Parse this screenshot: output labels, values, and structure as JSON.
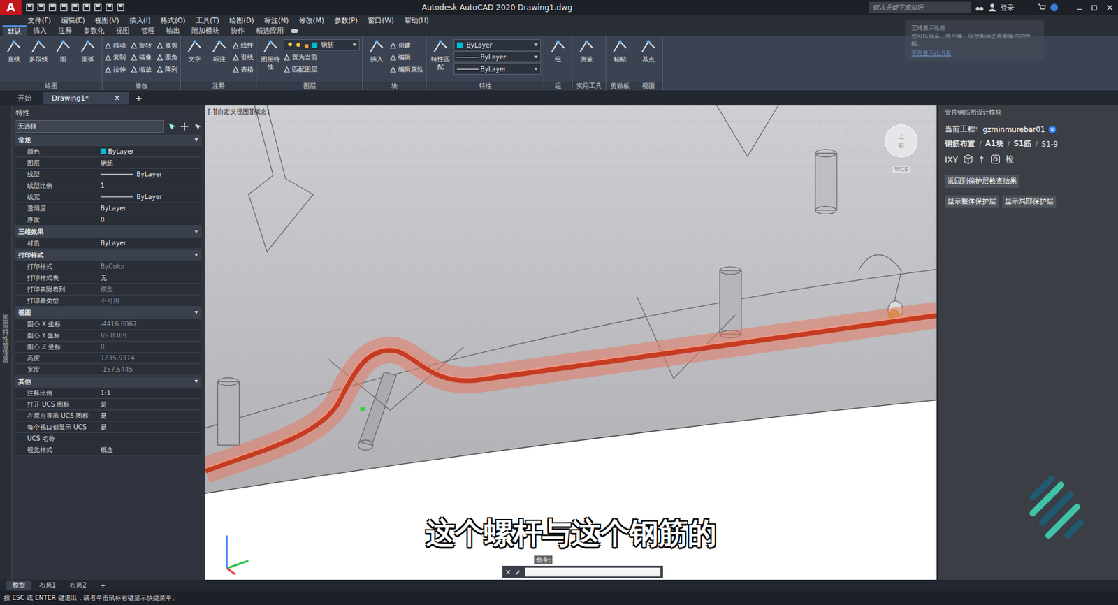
{
  "window": {
    "app_icon": "A",
    "title": "Autodesk AutoCAD 2020    Drawing1.dwg",
    "search_placeholder": "键入关键字或短语",
    "login": "登录"
  },
  "menu": [
    "文件(F)",
    "编辑(E)",
    "视图(V)",
    "插入(I)",
    "格式(O)",
    "工具(T)",
    "绘图(D)",
    "标注(N)",
    "修改(M)",
    "参数(P)",
    "窗口(W)",
    "帮助(H)"
  ],
  "ribbon_tabs": [
    {
      "label": "默认",
      "selected": true
    },
    {
      "label": "插入",
      "selected": false
    },
    {
      "label": "注释",
      "selected": false
    },
    {
      "label": "参数化",
      "selected": false
    },
    {
      "label": "视图",
      "selected": false
    },
    {
      "label": "管理",
      "selected": false
    },
    {
      "label": "输出",
      "selected": false
    },
    {
      "label": "附加模块",
      "selected": false
    },
    {
      "label": "协作",
      "selected": false
    },
    {
      "label": "精选应用",
      "selected": false
    }
  ],
  "ribbon_groups": [
    {
      "title": "绘图",
      "large": [
        "直线",
        "多段线",
        "圆",
        "圆弧"
      ],
      "dropdowns": [],
      "small": []
    },
    {
      "title": "修改",
      "large": [],
      "dropdowns": [],
      "small": [
        "移动",
        "复制",
        "拉伸",
        "旋转",
        "镜像",
        "缩放",
        "修剪",
        "圆角",
        "阵列"
      ]
    },
    {
      "title": "注释",
      "large": [
        "文字",
        "标注"
      ],
      "dropdowns": [],
      "small": [
        "线性",
        "引线",
        "表格"
      ]
    },
    {
      "title": "图层",
      "large": [
        "图层特性"
      ],
      "dropdowns": [
        {
          "label": "钢筋",
          "kind": "layer",
          "color": "#00bcd4"
        }
      ],
      "small": [
        "置为当前",
        "匹配图层"
      ]
    },
    {
      "title": "块",
      "large": [
        "插入"
      ],
      "dropdowns": [],
      "small": [
        "创建",
        "编辑",
        "编辑属性"
      ]
    },
    {
      "title": "特性",
      "large": [
        "特性匹配"
      ],
      "dropdowns": [
        {
          "label": "ByLayer",
          "kind": "color",
          "color": "#00bcd4"
        },
        {
          "label": "ByLayer",
          "kind": "line",
          "color": "#dddddd"
        },
        {
          "label": "ByLayer",
          "kind": "line",
          "color": "#dddddd"
        }
      ],
      "small": []
    },
    {
      "title": "组",
      "large": [
        "组"
      ],
      "dropdowns": [],
      "small": []
    },
    {
      "title": "实用工具",
      "large": [
        "测量"
      ],
      "dropdowns": [],
      "small": []
    },
    {
      "title": "剪贴板",
      "large": [
        "粘贴"
      ],
      "dropdowns": [],
      "small": []
    },
    {
      "title": "视图",
      "large": [
        "基点"
      ],
      "dropdowns": [],
      "small": []
    }
  ],
  "notification": {
    "title": "三维显示性能",
    "body": "您可以提高三维平移、缩放和动态观察操作的性能。",
    "link": "不再显示此消息"
  },
  "doc_tabs": [
    {
      "label": "开始",
      "selected": false
    },
    {
      "label": "Drawing1*",
      "selected": true
    }
  ],
  "doc_tab_close": "×",
  "doc_tab_new": "+",
  "side_strip": "图层特性管理器",
  "properties": {
    "title": "特性",
    "selection": "无选择",
    "toggle": "▾",
    "sections": [
      {
        "title": "常规",
        "expanded": true,
        "rows": [
          {
            "label": "颜色",
            "value": "ByLayer",
            "kind": "swatch",
            "color": "#00bcd4",
            "disabled": false
          },
          {
            "label": "图层",
            "value": "钢筋",
            "kind": "plain",
            "color": "",
            "disabled": false
          },
          {
            "label": "线型",
            "value": "ByLayer",
            "kind": "line",
            "color": "",
            "disabled": false
          },
          {
            "label": "线型比例",
            "value": "1",
            "kind": "plain",
            "color": "",
            "disabled": false
          },
          {
            "label": "线宽",
            "value": "ByLayer",
            "kind": "line",
            "color": "",
            "disabled": false
          },
          {
            "label": "透明度",
            "value": "ByLayer",
            "kind": "plain",
            "color": "",
            "disabled": false
          },
          {
            "label": "厚度",
            "value": "0",
            "kind": "plain",
            "color": "",
            "disabled": false
          }
        ]
      },
      {
        "title": "三维效果",
        "expanded": true,
        "rows": [
          {
            "label": "材质",
            "value": "ByLayer",
            "kind": "plain",
            "color": "",
            "disabled": false
          }
        ]
      },
      {
        "title": "打印样式",
        "expanded": true,
        "rows": [
          {
            "label": "打印样式",
            "value": "ByColor",
            "kind": "plain",
            "color": "",
            "disabled": true
          },
          {
            "label": "打印样式表",
            "value": "无",
            "kind": "plain",
            "color": "",
            "disabled": false
          },
          {
            "label": "打印表附着到",
            "value": "模型",
            "kind": "plain",
            "color": "",
            "disabled": true
          },
          {
            "label": "打印表类型",
            "value": "不可用",
            "kind": "plain",
            "color": "",
            "disabled": true
          }
        ]
      },
      {
        "title": "视图",
        "expanded": true,
        "rows": [
          {
            "label": "圆心 X 坐标",
            "value": "-4416.8067",
            "kind": "plain",
            "color": "",
            "disabled": true
          },
          {
            "label": "圆心 Y 坐标",
            "value": "65.8369",
            "kind": "plain",
            "color": "",
            "disabled": true
          },
          {
            "label": "圆心 Z 坐标",
            "value": "0",
            "kind": "plain",
            "color": "",
            "disabled": true
          },
          {
            "label": "高度",
            "value": "1235.9314",
            "kind": "plain",
            "color": "",
            "disabled": true
          },
          {
            "label": "宽度",
            "value": "-157.5445",
            "kind": "plain",
            "color": "",
            "disabled": true
          }
        ]
      },
      {
        "title": "其他",
        "expanded": true,
        "rows": [
          {
            "label": "注释比例",
            "value": "1:1",
            "kind": "plain",
            "color": "",
            "disabled": false
          },
          {
            "label": "打开 UCS 图标",
            "value": "是",
            "kind": "plain",
            "color": "",
            "disabled": false
          },
          {
            "label": "在原点显示 UCS 图标",
            "value": "是",
            "kind": "plain",
            "color": "",
            "disabled": false
          },
          {
            "label": "每个视口都显示 UCS",
            "value": "是",
            "kind": "plain",
            "color": "",
            "disabled": false
          },
          {
            "label": "UCS 名称",
            "value": "",
            "kind": "plain",
            "color": "",
            "disabled": false
          },
          {
            "label": "视觉样式",
            "value": "概念",
            "kind": "plain",
            "color": "",
            "disabled": false
          }
        ]
      }
    ]
  },
  "viewport": {
    "label": "[-][自定义视图][概念]",
    "cube_top": "上",
    "cube_right": "右",
    "wcs": "WCS",
    "subtitle": "这个螺杆与这个钢筋的",
    "command_label": "命令:",
    "command_close": "×"
  },
  "right_panel": {
    "title": "管片钢筋图设计模块",
    "project_label": "当前工程:",
    "project": "gzminmurebar01",
    "breadcrumb": [
      "钢筋布置",
      "A1块",
      "S1筋",
      "S1-9"
    ],
    "breadcrumb_sep": "/",
    "tools": [
      {
        "kind": "text",
        "label": "IXY"
      },
      {
        "kind": "cube",
        "label": ""
      },
      {
        "kind": "text",
        "label": "↑"
      },
      {
        "kind": "target",
        "label": ""
      },
      {
        "kind": "text",
        "label": "检"
      }
    ],
    "buttons": [
      "返回到保护层检查结果",
      "显示整体保护层",
      "显示局部保护层"
    ]
  },
  "layout_tabs": [
    {
      "label": "模型",
      "selected": true
    },
    {
      "label": "布局1",
      "selected": false
    },
    {
      "label": "布局2",
      "selected": false
    }
  ],
  "layout_tab_new": "+",
  "status": "按 ESC 或 ENTER 键退出，或者单击鼠标右键显示快捷菜单。"
}
